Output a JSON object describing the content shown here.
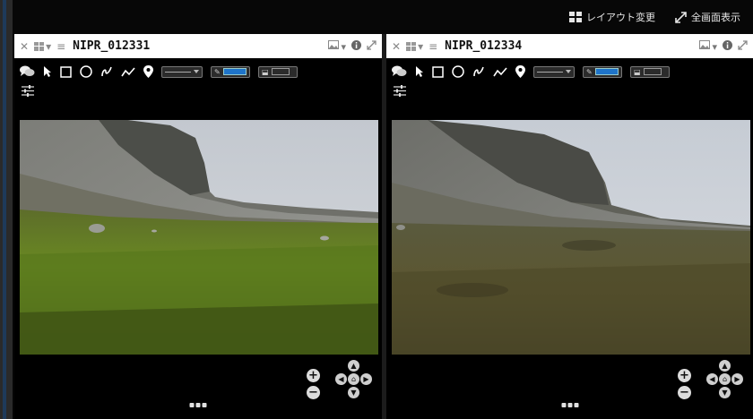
{
  "topbar": {
    "layout_label": "レイアウト変更",
    "fullscreen_label": "全画面表示"
  },
  "viewers": [
    {
      "title": "NIPR_012331",
      "menu_icons": [
        "close-icon",
        "grid-icon",
        "list-icon"
      ],
      "header_icons": [
        "image-icon",
        "info-icon",
        "expand-icon"
      ],
      "tools": [
        "comment-icon",
        "select-arrow-icon",
        "rectangle-icon",
        "circle-icon",
        "freehand-icon",
        "polyline-icon",
        "pin-icon",
        "line-style-dropdown",
        "stroke-color",
        "fill-color"
      ],
      "stroke_color": "#1f74c9"
    },
    {
      "title": "NIPR_012334",
      "menu_icons": [
        "close-icon",
        "grid-icon",
        "list-icon"
      ],
      "header_icons": [
        "image-icon",
        "info-icon",
        "expand-icon"
      ],
      "tools": [
        "comment-icon",
        "select-arrow-icon",
        "rectangle-icon",
        "circle-icon",
        "freehand-icon",
        "polyline-icon",
        "pin-icon",
        "line-style-dropdown",
        "stroke-color",
        "fill-color"
      ],
      "stroke_color": "#1f74c9"
    }
  ],
  "colors": {
    "sky": "#c9cfd6",
    "cliff": "#5b5c56",
    "scree": "#8e8f8a",
    "meadow_green": "#5c7a22",
    "meadow_brown": "#5a5330",
    "accent_blue": "#1f74c9"
  }
}
